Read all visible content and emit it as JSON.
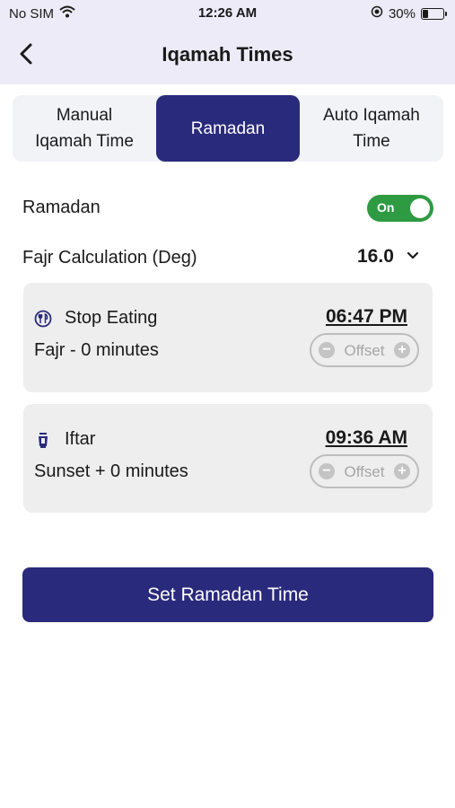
{
  "status_bar": {
    "carrier": "No SIM",
    "time": "12:26 AM",
    "battery": "30%",
    "battery_level": 0.3
  },
  "header": {
    "title": "Iqamah Times"
  },
  "tabs": [
    {
      "label": "Manual\nIqamah Time",
      "active": false
    },
    {
      "label": "Ramadan",
      "active": true
    },
    {
      "label": "Auto Iqamah\nTime",
      "active": false
    }
  ],
  "ramadan": {
    "label": "Ramadan",
    "toggle": "On"
  },
  "fajr_calc": {
    "label": "Fajr Calculation (Deg)",
    "value": "16.0"
  },
  "stop_eating": {
    "name": "Stop Eating",
    "time": "06:47 PM",
    "subtitle": "Fajr - 0 minutes",
    "offset_label": "Offset"
  },
  "iftar": {
    "name": "Iftar",
    "time": "09:36 AM",
    "subtitle": "Sunset + 0 minutes",
    "offset_label": "Offset"
  },
  "submit": {
    "label": "Set Ramadan Time"
  },
  "colors": {
    "accent": "#2a2a7c",
    "toggle_on": "#2e9a42",
    "header_bg": "#ecebf7",
    "card_bg": "#eeeeee"
  }
}
